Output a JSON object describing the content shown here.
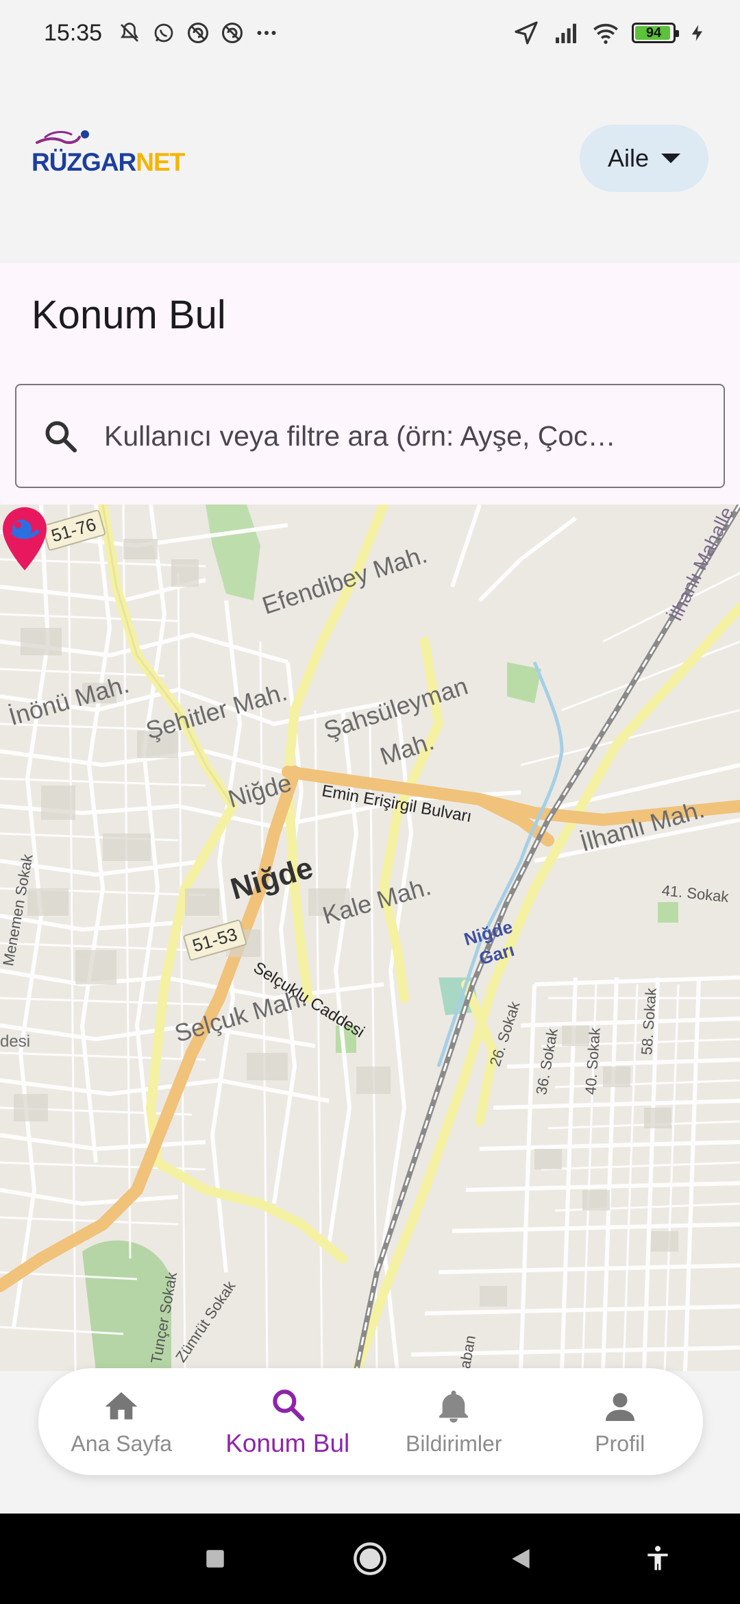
{
  "status_bar": {
    "time": "15:35",
    "battery_level": "94",
    "battery_fraction": 0.94
  },
  "header": {
    "logo_text_1": "RÜZGAR",
    "logo_text_2": "NET",
    "role_select_value": "Aile"
  },
  "page": {
    "title": "Konum Bul",
    "search_placeholder": "Kullanıcı veya filtre ara (örn: Ayşe, Çoc…"
  },
  "map": {
    "labels": {
      "efendibey": "Efendibey Mah.",
      "inonu": "İnönü Mah.",
      "sehitler": "Şehitler Mah.",
      "sahsuleyman_1": "Şahsüleyman",
      "sahsuleyman_2": "Mah.",
      "nigde_small": "Niğde",
      "nigde_big": "Niğde",
      "emin": "Emin Erişirgil Bulvarı",
      "ilhanli": "İlhanlı Mah.",
      "ilhanli_edge": "İlhanlı Mahalle",
      "kale": "Kale Mah.",
      "selcuklu": "Selçuklu Caddesi",
      "selcuk": "Selçuk Mah.",
      "menemen": "Menemen Sokak",
      "tuncer": "Tunçer Sokak",
      "zumrut": "Zümrüt Sokak",
      "sokak_26": "26. Sokak",
      "sokak_36": "36. Sokak",
      "sokak_40": "40. Sokak",
      "sokak_58": "58. Sokak",
      "sokak_41": "41. Sokak",
      "station_1": "Niğde",
      "station_2": "Garı",
      "desi": "desi",
      "saban": "Saban"
    },
    "shields": {
      "top": "51-76",
      "bottom": "51-53"
    }
  },
  "bottom_nav": {
    "items": [
      {
        "label": "Ana Sayfa",
        "icon": "home-icon"
      },
      {
        "label": "Konum Bul",
        "icon": "search-icon"
      },
      {
        "label": "Bildirimler",
        "icon": "bell-icon"
      },
      {
        "label": "Profil",
        "icon": "person-icon"
      }
    ],
    "active_index": 1,
    "active_color": "#8e24aa",
    "inactive_color": "#8c8c8c"
  }
}
